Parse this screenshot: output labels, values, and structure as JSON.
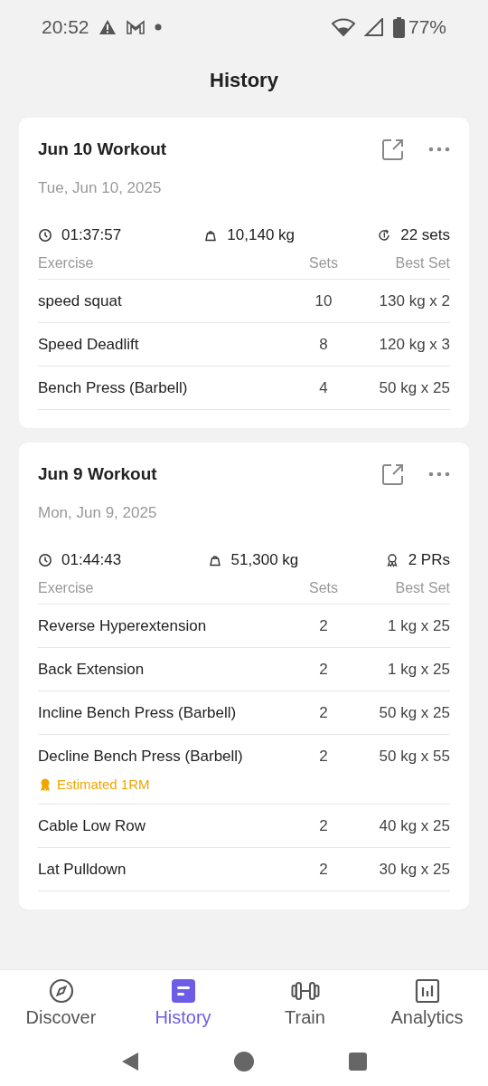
{
  "status_bar": {
    "time": "20:52",
    "battery": "77%"
  },
  "title": "History",
  "workouts": [
    {
      "name": "Jun 10 Workout",
      "date": "Tue, Jun 10, 2025",
      "stats": [
        {
          "kind": "duration",
          "text": "01:37:57"
        },
        {
          "kind": "volume",
          "text": "10,140 kg"
        },
        {
          "kind": "sets",
          "text": "22 sets"
        }
      ],
      "columns": [
        "Exercise",
        "Sets",
        "Best Set"
      ],
      "rows": [
        {
          "exercise": "speed squat",
          "sets": "10",
          "best": "130 kg x 2"
        },
        {
          "exercise": "Speed Deadlift",
          "sets": "8",
          "best": "120 kg x 3"
        },
        {
          "exercise": "Bench Press (Barbell)",
          "sets": "4",
          "best": "50 kg x 25"
        }
      ]
    },
    {
      "name": "Jun 9 Workout",
      "date": "Mon, Jun 9, 2025",
      "stats": [
        {
          "kind": "duration",
          "text": "01:44:43"
        },
        {
          "kind": "volume",
          "text": "51,300 kg"
        },
        {
          "kind": "prs",
          "text": "2 PRs"
        }
      ],
      "columns": [
        "Exercise",
        "Sets",
        "Best Set"
      ],
      "rows": [
        {
          "exercise": "Reverse Hyperextension",
          "sets": "2",
          "best": "1 kg x 25"
        },
        {
          "exercise": "Back Extension",
          "sets": "2",
          "best": "1 kg x 25"
        },
        {
          "exercise": "Incline Bench Press (Barbell)",
          "sets": "2",
          "best": "50 kg x 25"
        },
        {
          "exercise": "Decline Bench Press (Barbell)",
          "sets": "2",
          "best": "50 kg x 55",
          "badge": "Estimated 1RM"
        },
        {
          "exercise": "Cable Low Row",
          "sets": "2",
          "best": "40 kg x 25"
        },
        {
          "exercise": "Lat Pulldown",
          "sets": "2",
          "best": "30 kg x 25"
        }
      ]
    }
  ],
  "tabs": [
    {
      "label": "Discover",
      "kind": "discover",
      "selected": false
    },
    {
      "label": "History",
      "kind": "history",
      "selected": true
    },
    {
      "label": "Train",
      "kind": "train",
      "selected": false
    },
    {
      "label": "Analytics",
      "kind": "analytics",
      "selected": false
    }
  ]
}
